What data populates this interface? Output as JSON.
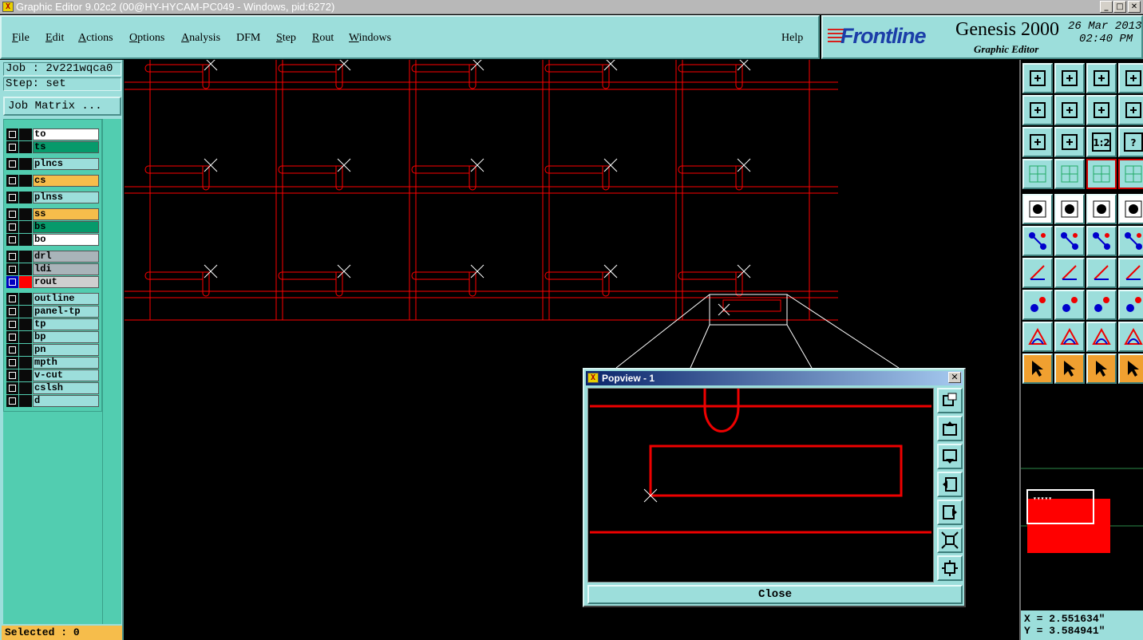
{
  "window": {
    "title": "Graphic Editor 9.02c2 (00@HY-HYCAM-PC049 - Windows, pid:6272)",
    "minimize": "_",
    "maximize": "□",
    "close": "✕"
  },
  "menu": {
    "items": [
      {
        "label": "File",
        "u": "F",
        "rest": "ile"
      },
      {
        "label": "Edit",
        "u": "E",
        "rest": "dit"
      },
      {
        "label": "Actions",
        "u": "A",
        "rest": "ctions"
      },
      {
        "label": "Options",
        "u": "O",
        "rest": "ptions"
      },
      {
        "label": "Analysis",
        "u": "A",
        "rest": "nalysis"
      },
      {
        "label": "DFM",
        "u": "",
        "rest": "DFM"
      },
      {
        "label": "Step",
        "u": "S",
        "rest": "tep"
      },
      {
        "label": "Rout",
        "u": "R",
        "rest": "out"
      },
      {
        "label": "Windows",
        "u": "W",
        "rest": "indows"
      }
    ],
    "help": "Help"
  },
  "brand": {
    "logo": "Frontline",
    "product": "Genesis 2000",
    "subtitle": "Graphic Editor",
    "date": "26 Mar 2013",
    "time": "02:40 PM"
  },
  "job": {
    "job_line": "Job : 2v221wqca0",
    "step_line": "Step: set",
    "matrix_button": "Job Matrix ..."
  },
  "layers": [
    {
      "name": "to",
      "color": "#ffffff"
    },
    {
      "name": "ts",
      "color": "#079a6b"
    },
    {
      "name": "plncs",
      "color": "#9cdedb"
    },
    {
      "name": "cs",
      "color": "#f6bd4b"
    },
    {
      "name": "plnss",
      "color": "#9cdedb"
    },
    {
      "name": "ss",
      "color": "#f6bd4b"
    },
    {
      "name": "bs",
      "color": "#079a6b"
    },
    {
      "name": "bo",
      "color": "#ffffff"
    },
    {
      "name": "drl",
      "color": "#a9b4b9"
    },
    {
      "name": "ldi",
      "color": "#a9b4b9"
    },
    {
      "name": "rout",
      "color": "#cfcfcf",
      "active": true,
      "display_color": "#ff0000"
    },
    {
      "name": "outline",
      "color": "#9cdedb"
    },
    {
      "name": "panel-tp",
      "color": "#9cdedb"
    },
    {
      "name": "tp",
      "color": "#9cdedb"
    },
    {
      "name": "bp",
      "color": "#9cdedb"
    },
    {
      "name": "pn",
      "color": "#9cdedb"
    },
    {
      "name": "mpth",
      "color": "#9cdedb"
    },
    {
      "name": "v-cut",
      "color": "#9cdedb"
    },
    {
      "name": "cslsh",
      "color": "#9cdedb"
    },
    {
      "name": "d",
      "color": "#9cdedb"
    }
  ],
  "status": {
    "selected": "Selected : 0",
    "x": "X = 2.551634\"",
    "y": "Y = 3.584941\""
  },
  "popview": {
    "title": "Popview - 1",
    "close_label": "Close",
    "close_x": "✕"
  },
  "toolbar": {
    "zoom_ratio_label": "1:2",
    "help_label": "?"
  },
  "colors": {
    "panel": "#9cdedb",
    "layer_area": "#52cdb0",
    "rout": "#ff0000",
    "selected_bar": "#f6bd4b"
  }
}
